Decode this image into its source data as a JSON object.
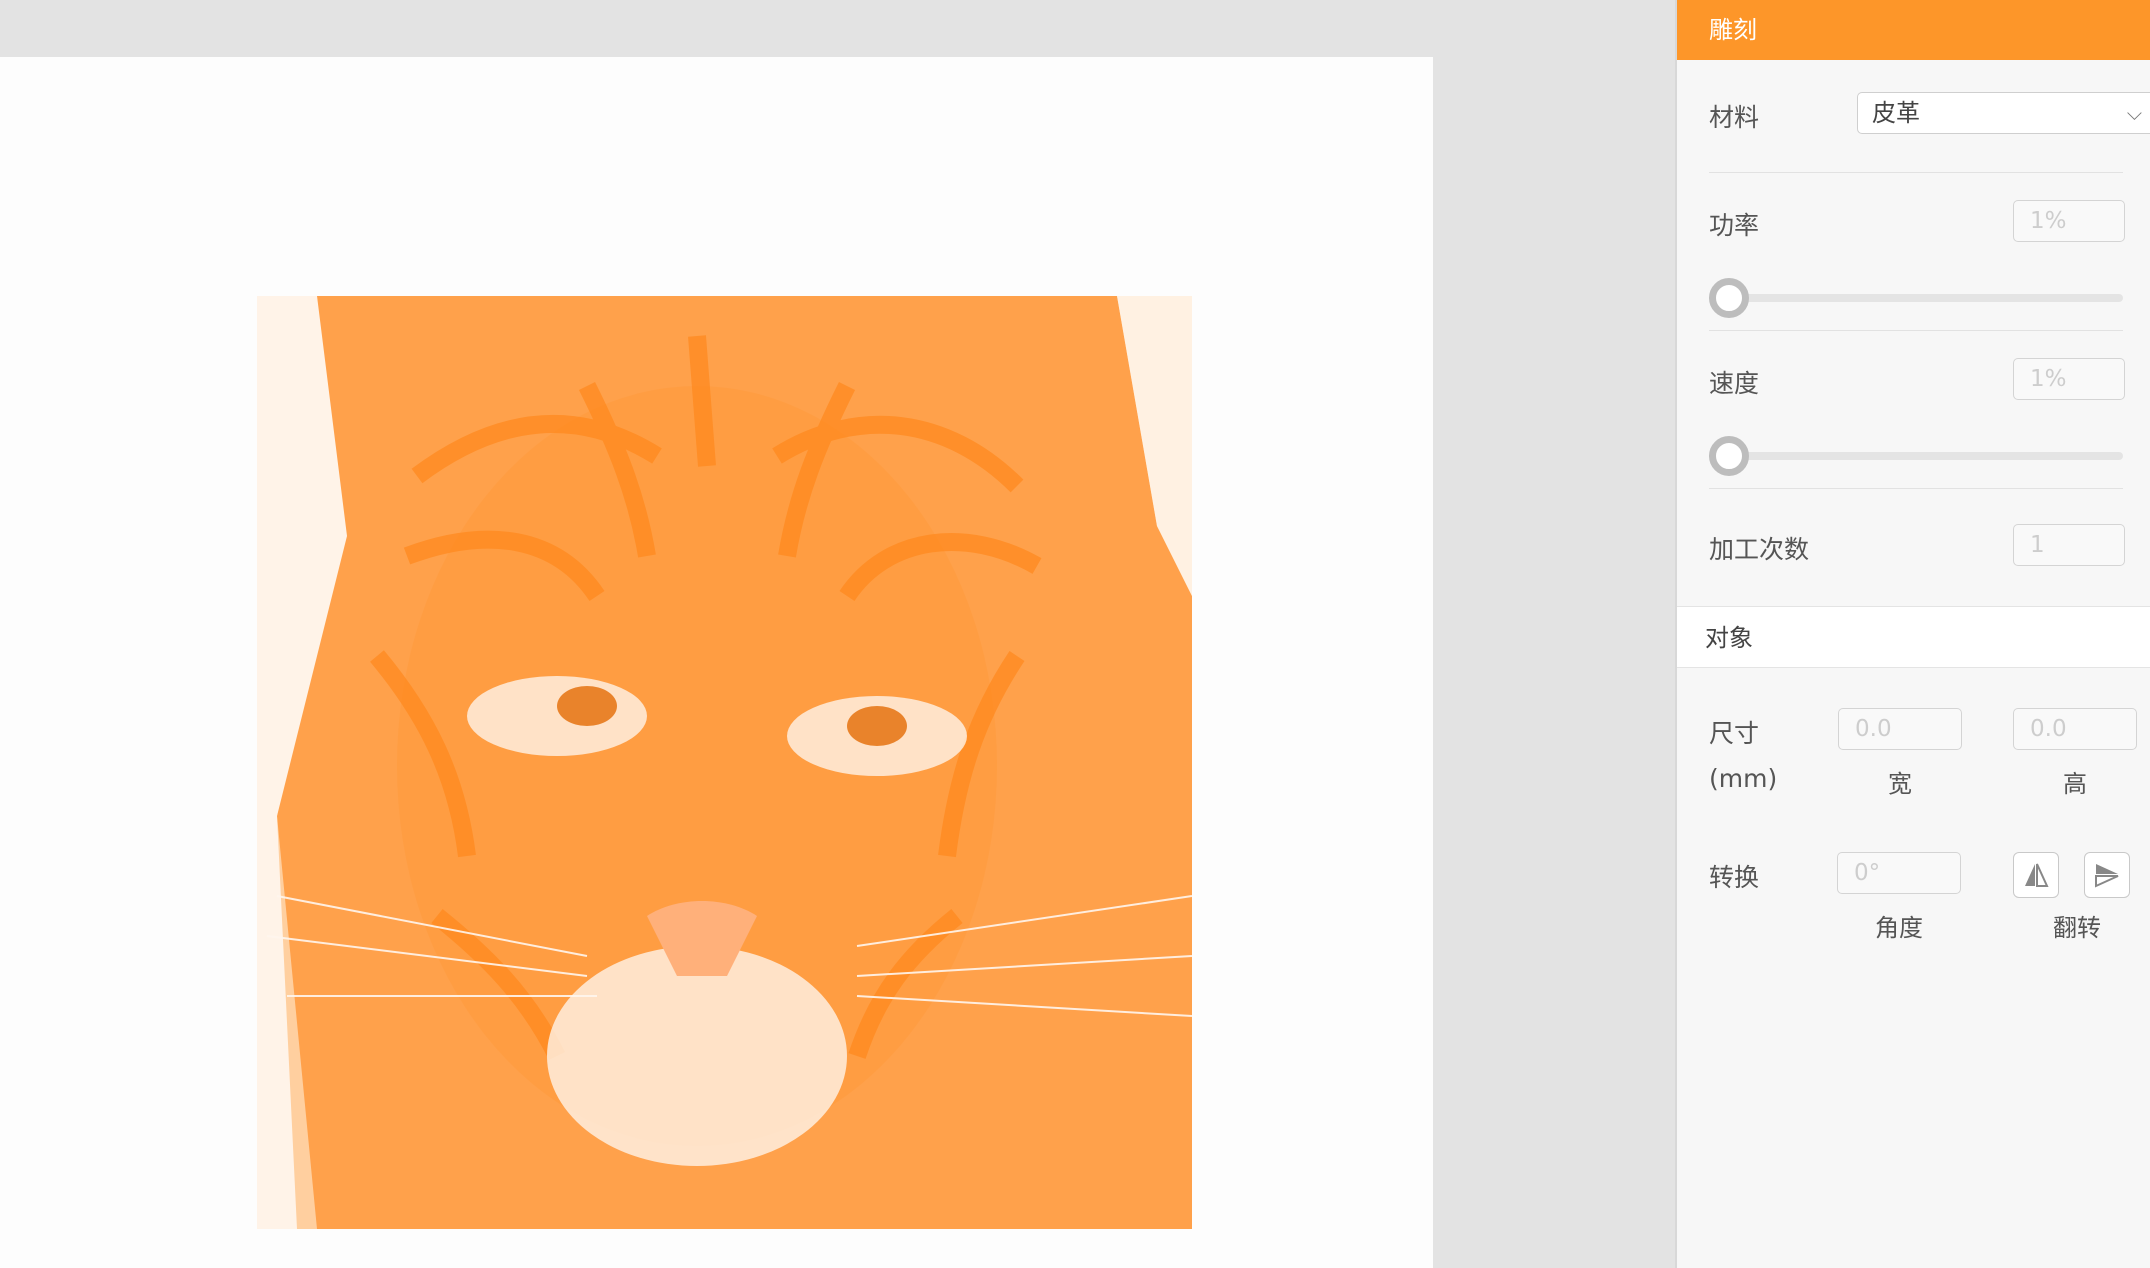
{
  "panel": {
    "title": "雕刻",
    "material": {
      "label": "材料",
      "value": "皮革"
    },
    "power": {
      "label": "功率",
      "value": "1%",
      "level": 0.01
    },
    "speed": {
      "label": "速度",
      "value": "1%",
      "level": 0.01
    },
    "passes": {
      "label": "加工次数",
      "value": "1"
    },
    "object": {
      "section_title": "对象",
      "size": {
        "label": "尺寸",
        "unit": "(mm)",
        "width_value": "0.0",
        "height_value": "0.0",
        "width_label": "宽",
        "height_label": "高"
      },
      "transform": {
        "label": "转换",
        "angle_value": "0°",
        "angle_label": "角度",
        "flip_label": "翻转"
      }
    }
  },
  "colors": {
    "accent": "#fd9629",
    "image_tint": "#ff9b3e"
  },
  "icons": {
    "dropdown": "chevron-down-icon",
    "flip_horizontal": "flip-horizontal-icon",
    "flip_vertical": "flip-vertical-icon"
  }
}
